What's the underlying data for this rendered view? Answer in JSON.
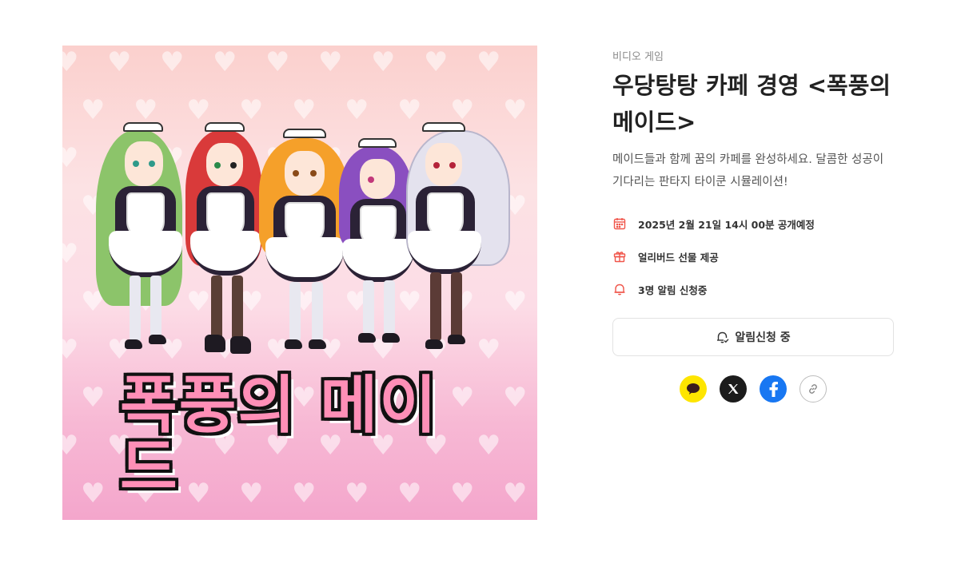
{
  "product": {
    "category": "비디오 게임",
    "title": "우당탕탕 카페 경영 <폭풍의 메이드>",
    "description": "메이드들과 함께 꿈의 카페를 완성하세요. 달콤한 성공이 기다리는 판타지 타이쿤 시뮬레이션!",
    "image_logo_text": "폭풍의 메이드"
  },
  "info": [
    {
      "icon": "calendar-icon",
      "text": "2025년 2월 21일 14시 00분 공개예정"
    },
    {
      "icon": "gift-icon",
      "text": "얼리버드 선물 제공"
    },
    {
      "icon": "bell-icon",
      "text": "3명 알림 신청중"
    }
  ],
  "notify_button": {
    "icon": "bell-check-icon",
    "label": "알림신청 중"
  },
  "share": [
    {
      "name": "kakaotalk-share-icon"
    },
    {
      "name": "x-share-icon"
    },
    {
      "name": "facebook-share-icon"
    },
    {
      "name": "link-copy-icon"
    }
  ],
  "colors": {
    "accent": "#f0554a",
    "kakao": "#fee500",
    "x": "#1c1c1c",
    "facebook": "#1877f2"
  }
}
